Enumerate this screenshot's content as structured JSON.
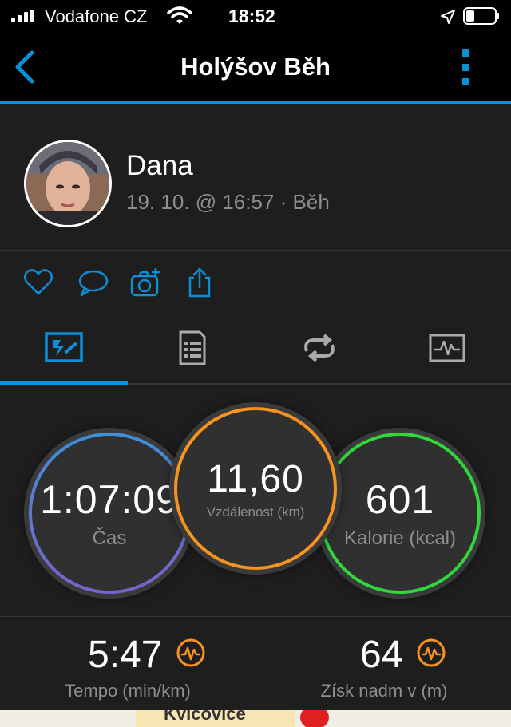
{
  "status_bar": {
    "carrier": "Vodafone CZ",
    "time": "18:52"
  },
  "nav": {
    "title": "Holýšov Běh"
  },
  "profile": {
    "name": "Dana",
    "meta": "19. 10. @ 16:57 · Běh"
  },
  "circles": {
    "time": {
      "value": "1:07:09",
      "label": "Čas"
    },
    "distance": {
      "value": "11,60",
      "label": "Vzdálenost (km)"
    },
    "calories": {
      "value": "601",
      "label": "Kalorie (kcal)"
    }
  },
  "summary": {
    "pace": {
      "value": "5:47",
      "label": "Tempo (min/km)"
    },
    "elevation": {
      "value": "64",
      "label": "Získ nadm v (m)"
    }
  },
  "map": {
    "label": "Kvíčovice"
  },
  "colors": {
    "accent": "#0a8fd8",
    "distance_ring": "#f7931e",
    "calories_ring": "#2fd83a",
    "time_ring_top": "#3d8fd8",
    "time_ring_bottom": "#7a62c8",
    "pulse_icon": "#f7931e"
  },
  "icons": {
    "signal": "signal-bars-icon",
    "wifi": "wifi-icon",
    "location": "location-arrow-icon",
    "battery": "battery-icon",
    "back": "chevron-left-icon",
    "more": "more-vertical-icon",
    "actions": [
      "heart-icon",
      "comment-icon",
      "camera-add-icon",
      "share-icon"
    ],
    "tabs": [
      "overview-tab-icon",
      "details-tab-icon",
      "laps-tab-icon",
      "charts-tab-icon"
    ]
  }
}
